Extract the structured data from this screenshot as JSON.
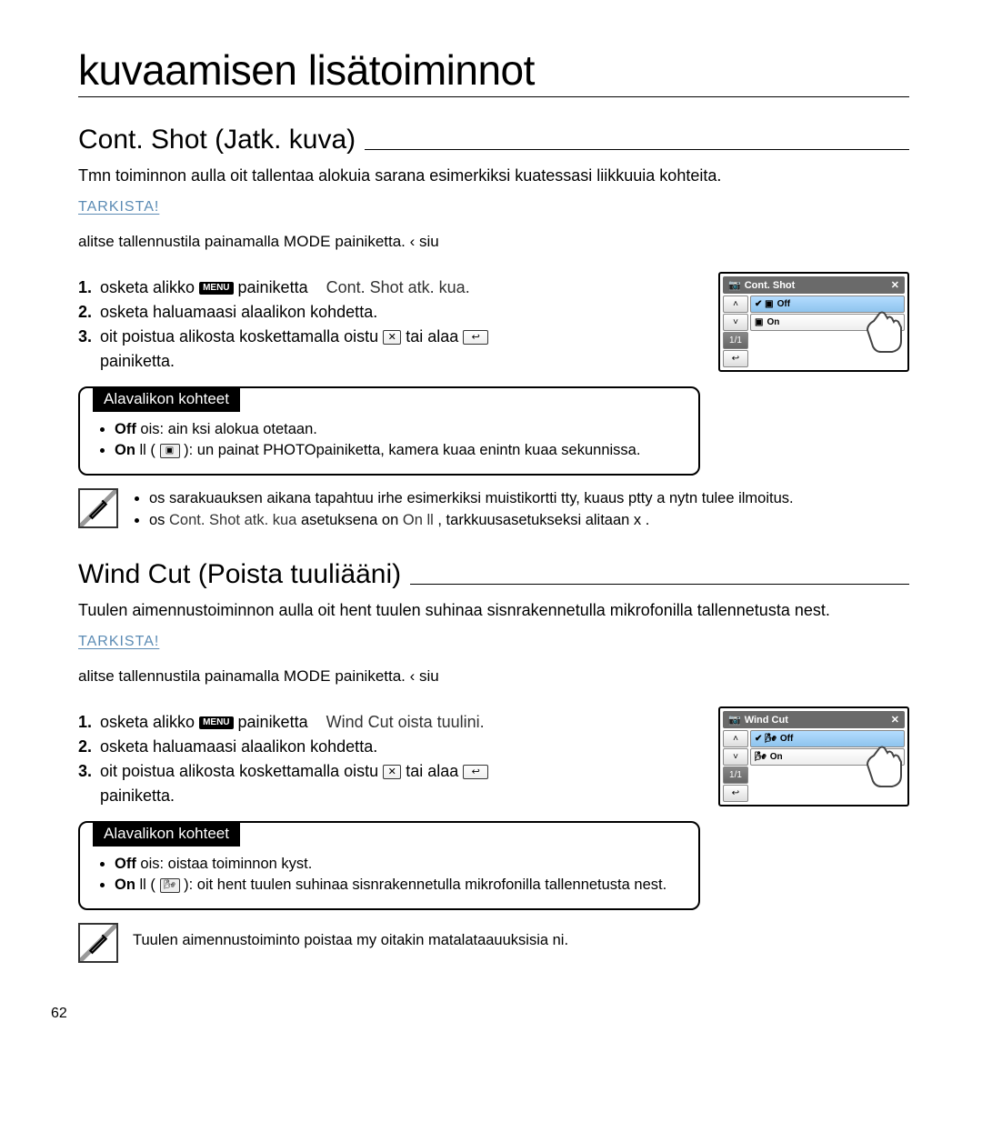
{
  "page": {
    "main_title": "kuvaamisen lisätoiminnot",
    "page_number": "62"
  },
  "section1": {
    "title": "Cont. Shot (Jatk. kuva)",
    "intro": "Tmn toiminnon aulla oit tallentaa alokuia sarana esimerkiksi kuatessasi liikkuuia kohteita.",
    "tarkista": "TARKISTA!",
    "precheck": "alitse tallennustila painamalla ",
    "mode_word": "MODE",
    "precheck_after": "painiketta.         ‹ siu ",
    "steps": {
      "s1a": "osketa alikko ",
      "s1b": "painiketta",
      "s1c": "Cont. Shot atk. kua.",
      "s2": "osketa haluamaasi alaalikon kohdetta.",
      "s3a": "oit poistua alikosta koskettamalla oistu ",
      "s3b": " tai alaa ",
      "s3c": "painiketta."
    },
    "sub_title": "Alavalikon kohteet",
    "sub_items": {
      "off_label": "Off",
      "off_text": " ois: ain ksi alokua otetaan.",
      "on_label": "On",
      "on_text_a": " ll ( ",
      "on_text_b": " ): un painat ",
      "on_photo": "PHOTO",
      "on_text_c": "painiketta, kamera kuaa enintn  kuaa sekunnissa."
    },
    "note_items": {
      "a": "os sarakuauksen aikana tapahtuu irhe esimerkiksi muistikortti tty, kuaus ptty a nytn tulee ilmoitus.",
      "b_a": "os ",
      "b_light": "Cont. Shot  atk. kua ",
      "b_mid": "asetuksena on ",
      "b_light2": "On ll",
      "b_end": ", tarkkuusasetukseksi alitaan x ."
    },
    "screen": {
      "title": "Cont. Shot",
      "off": "Off",
      "on": "On",
      "page": "1/1"
    }
  },
  "section2": {
    "title": "Wind Cut (Poista tuuliääni)",
    "intro": "Tuulen aimennustoiminnon aulla oit hent tuulen suhinaa sisnrakennetulla mikrofonilla tallennetusta nest.",
    "tarkista": "TARKISTA!",
    "precheck": "alitse tallennustila painamalla ",
    "mode_word": "MODE",
    "precheck_after": "painiketta.         ‹ siu ",
    "steps": {
      "s1a": "osketa alikko ",
      "s1b": "painiketta",
      "s1c": "Wind Cut oista tuulini.",
      "s2": "osketa haluamaasi alaalikon kohdetta.",
      "s3a": "oit poistua alikosta koskettamalla oistu ",
      "s3b": " tai alaa ",
      "s3c": "painiketta."
    },
    "sub_title": "Alavalikon kohteet",
    "sub_items": {
      "off_label": "Off",
      "off_text": " ois: oistaa toiminnon kyst.",
      "on_label": "On",
      "on_text_a": " ll ( ",
      "on_text_b": " ): oit hent tuulen suhinaa sisnrakennetulla mikrofonilla tallennetusta nest."
    },
    "note_single": "Tuulen aimennustoiminto poistaa my oitakin matalataauuksisia ni.",
    "screen": {
      "title": "Wind Cut",
      "off": "Off",
      "on": "On",
      "page": "1/1"
    }
  }
}
